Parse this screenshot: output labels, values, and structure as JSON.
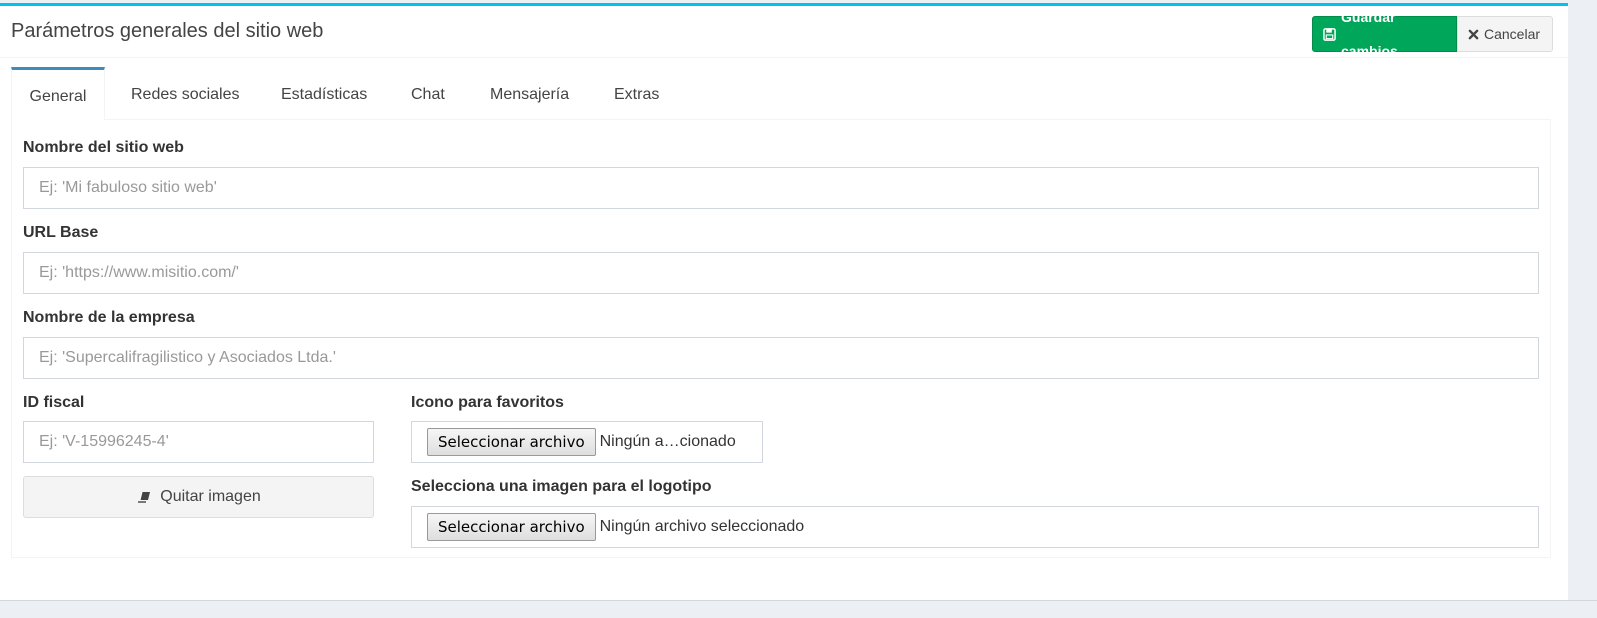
{
  "header": {
    "title": "Parámetros generales del sitio web",
    "save_label": "Guardar cambios",
    "cancel_label": "Cancelar"
  },
  "tabs": [
    {
      "label": "General",
      "active": true
    },
    {
      "label": "Redes sociales"
    },
    {
      "label": "Estadísticas"
    },
    {
      "label": "Chat"
    },
    {
      "label": "Mensajería"
    },
    {
      "label": "Extras"
    }
  ],
  "form": {
    "site_name": {
      "label": "Nombre del sitio web",
      "placeholder": "Ej: 'Mi fabuloso sitio web'"
    },
    "base_url": {
      "label": "URL Base",
      "placeholder": "Ej: 'https://www.misitio.com/'"
    },
    "company": {
      "label": "Nombre de la empresa",
      "placeholder": "Ej: 'Supercalifragilistico y Asociados Ltda.'"
    },
    "fiscal_id": {
      "label": "ID fiscal",
      "placeholder": "Ej: 'V-15996245-4'"
    },
    "remove_image_label": "Quitar imagen",
    "favicon": {
      "label": "Icono para favoritos",
      "button": "Seleccionar archivo",
      "status": "Ningún a…cionado"
    },
    "logo": {
      "label": "Selecciona una imagen para el logotipo",
      "button": "Seleccionar archivo",
      "status": "Ningún archivo seleccionado"
    }
  },
  "colors": {
    "accent": "#00c0ef",
    "tab_active": "#3c8dbc",
    "save": "#00a65a"
  },
  "icons": {
    "save": "floppy-disk-icon",
    "cancel": "times-icon",
    "remove": "eraser-icon"
  }
}
